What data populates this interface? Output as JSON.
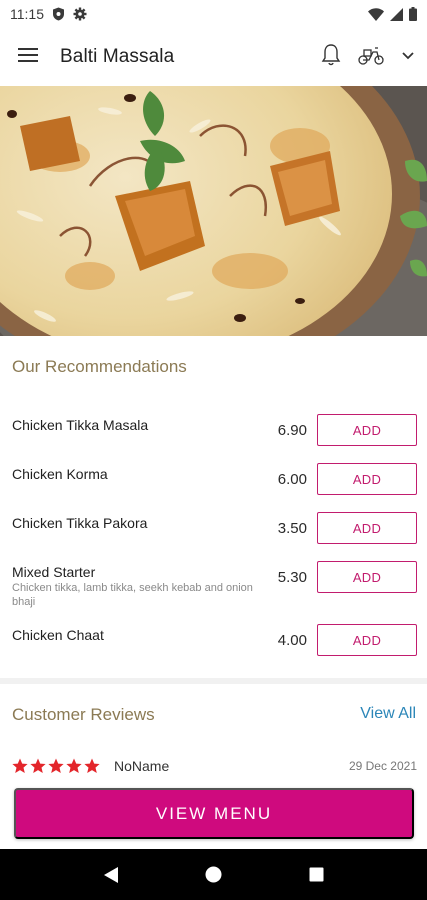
{
  "status_bar": {
    "time": "11:15"
  },
  "app_bar": {
    "title": "Balti Massala"
  },
  "recommendations": {
    "title": "Our Recommendations",
    "add_label": "ADD",
    "items": [
      {
        "name": "Chicken Tikka Masala",
        "price": "6.90",
        "description": ""
      },
      {
        "name": "Chicken Korma",
        "price": "6.00",
        "description": ""
      },
      {
        "name": "Chicken Tikka Pakora",
        "price": "3.50",
        "description": ""
      },
      {
        "name": "Mixed Starter",
        "price": "5.30",
        "description": "Chicken tikka, lamb tikka, seekh kebab and onion bhaji"
      },
      {
        "name": "Chicken Chaat",
        "price": "4.00",
        "description": ""
      }
    ]
  },
  "reviews": {
    "title": "Customer Reviews",
    "view_all": "View All",
    "items": [
      {
        "rating": 5,
        "name": "NoName",
        "date": "29 Dec 2021"
      }
    ]
  },
  "view_menu_label": "VIEW MENU",
  "colors": {
    "accent": "#cf0a7e",
    "add_border": "#c21c6e",
    "section_title": "#8b7a54",
    "link": "#2b86b8",
    "star": "#e3262b"
  },
  "icons": {
    "status_left": [
      "shield-icon",
      "gear-icon"
    ],
    "status_right": [
      "wifi-icon",
      "signal-icon",
      "battery-icon"
    ],
    "app_bar": [
      "menu-icon",
      "bell-icon",
      "scooter-icon",
      "chevron-down-icon"
    ],
    "nav": [
      "back-icon",
      "home-icon",
      "recents-icon"
    ]
  }
}
